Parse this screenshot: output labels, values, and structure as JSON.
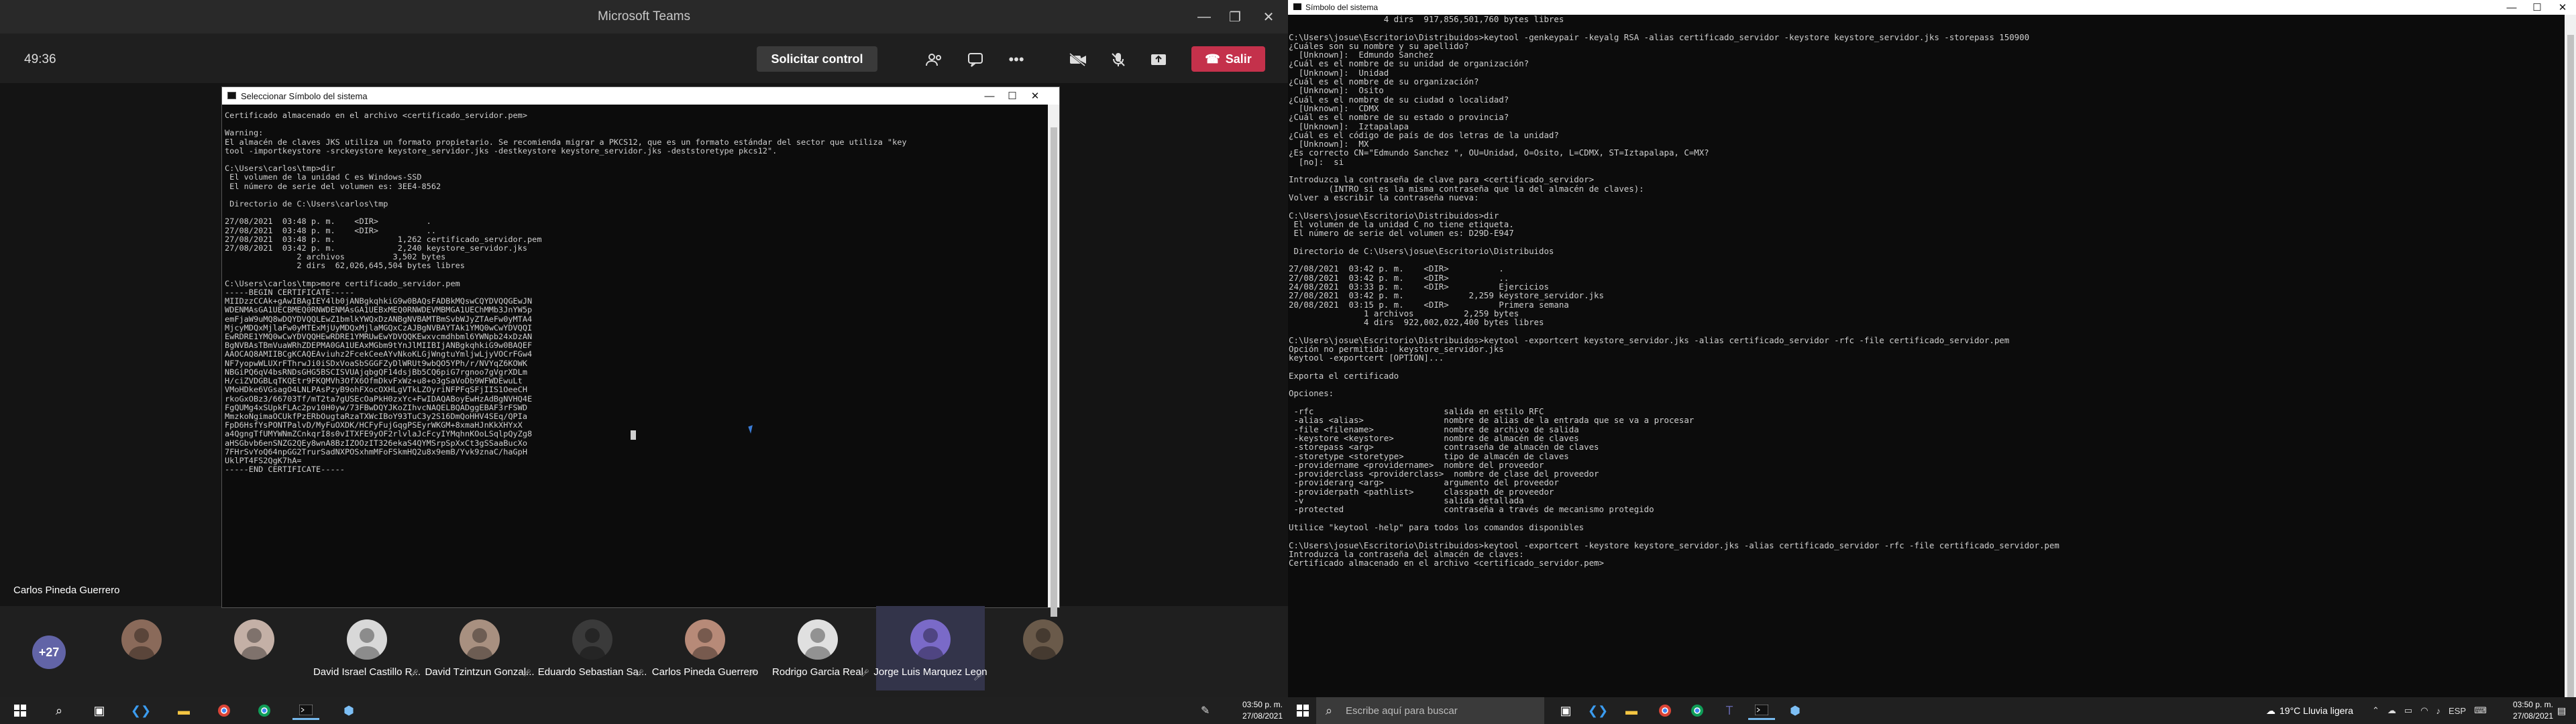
{
  "teams": {
    "title": "Microsoft Teams",
    "timer": "49:36",
    "request_control": "Solicitar control",
    "leave": "Salir",
    "presenter": "Carlos Pineda Guerrero",
    "more_count": "+27",
    "participants": [
      {
        "name": "",
        "color": "#8a6a5a"
      },
      {
        "name": "",
        "color": "#c4b0a6"
      },
      {
        "name": "David Israel Castillo R...",
        "color": "#d8d8d8"
      },
      {
        "name": "David Tzintzun Gonzal...",
        "color": "#a89080"
      },
      {
        "name": "Eduardo Sebastian Sa...",
        "color": "#3a3a3a"
      },
      {
        "name": "Carlos Pineda Guerrero",
        "color": "#b78a78"
      },
      {
        "name": "Rodrigo Garcia Real",
        "color": "#e0e0e0"
      },
      {
        "name": "Jorge Luis Marquez Leon",
        "color": "#7a6ac8"
      },
      {
        "name": "",
        "color": "#6a5a4a"
      }
    ]
  },
  "cmd1": {
    "title": "Seleccionar Símbolo del sistema",
    "text": "Certificado almacenado en el archivo <certificado_servidor.pem>\n\nWarning:\nEl almacén de claves JKS utiliza un formato propietario. Se recomienda migrar a PKCS12, que es un formato estándar del sector que utiliza \"key\ntool -importkeystore -srckeystore keystore_servidor.jks -destkeystore keystore_servidor.jks -deststoretype pkcs12\".\n\nC:\\Users\\carlos\\tmp>dir\n El volumen de la unidad C es Windows-SSD\n El número de serie del volumen es: 3EE4-8562\n\n Directorio de C:\\Users\\carlos\\tmp\n\n27/08/2021  03:48 p. m.    <DIR>          .\n27/08/2021  03:48 p. m.    <DIR>          ..\n27/08/2021  03:48 p. m.             1,262 certificado_servidor.pem\n27/08/2021  03:42 p. m.             2,240 keystore_servidor.jks\n               2 archivos          3,502 bytes\n               2 dirs  62,026,645,504 bytes libres\n\nC:\\Users\\carlos\\tmp>more certificado_servidor.pem\n-----BEGIN CERTIFICATE-----\nMIIDzzCCAk+gAwIBAgIEY4lb0jANBgkqhkiG9w0BAQsFADBkMQswCQYDVQQGEwJN\nWDENMAsGA1UECBMEQ0RNWDENMAsGA1UEBxMEQ0RNWDEVMBMGA1UEChMMb3JnYW5p\nemFjaW9uMQ8wDQYDVQQLEwZ1bmlkYWQxDzANBgNVBAMTBmSvbWJyZTAeFw0yMTA4\nMjcyMDQxMjlaFw0yMTExMjUyMDQxMjlaMGQxCzAJBgNVBAYTAk1YMQ0wCwYDVQQI\nEwRDRE1YMQ0wCwYDVQQHEwRDRE1YMRUwEwYDVQQKEwxvcmdhbml6YWNpb24xDzAN\nBgNVBAsTBmVuaWRhZDEPMA0GA1UEAxMGbm9tYnJlMIIBIjANBgkqhkiG9w0BAQEF\nAAOCAQ8AMIIBCgKCAQEAviuhz2FcekCeeAYvNkoKLGjWngtuYmljwLjyVOCrFGw4\nNF7yopwWLUXrFThrwJi0iSDxVoaSbSGGFZyDlWRUt9wbQO5YPh/r/NVYqZ6KOWK\nNBGiPQ6qV4bsRNDsGHG5BSCISVUAjqbgQF14dsjBb5CQ6piG7rgnoo7gVgrXDLm\nH/ciZVDGBLqTKQEtr9FKQMVh3OfX6OfmDkvFxWz+u8+o3gSaVoDb9WFWDEwuLt\nVMoHDke6VGsagO4LNLPAsPzyB9ohFXocOXHLgVTkLZOyriNFPFqSFjIIS1OeeCH\nrkoGxOBz3/66703Tf/mT2ta7gUSEcOaPkH0zxYc+FwIDAQABoyEwHzAdBgNVHQ4E\nFgQUMg4xSUpkFLAc2pv10H0yw/73FBwDQYJKoZIhvcNAQELBQADggEBAF3rFSWD\nMmzkoNgimaOCUkfPzERbOugtaRzaTXWcIBoY93TuC3y2S16DmQoHHV4SEq/QPIa\nFpD6HsfYsPONTPalvD/MyFuOXDK/HCFyFujGqgPSEyrWKGM+8xmaHJnKkXHYxX\na4QgngTfUMYWNmZCnkqrI8s0vITXFE9yOF2rlvlaJcFcyIYMqhnKOoLSqlpQyZg8\naHSGbvb6enSNZG2QEy8wnA8BzIZOOzIT326ekaS4QYMSrpSpXxCt3gSSaaBucXo\n7FHrSvYoQ64npGG2TrurSadNXPOSxhmMFoFSkmHQ2u8x9emB/Yvk9znaC/haGpH\nUklPT4FS2QgK7hA=\n-----END CERTIFICATE-----"
  },
  "cmd2": {
    "title": "Símbolo del sistema",
    "text": "                   4 dirs  917,856,501,760 bytes libres\n\nC:\\Users\\josue\\Escritorio\\Distribuidos>keytool -genkeypair -keyalg RSA -alias certificado_servidor -keystore keystore_servidor.jks -storepass 150900\n¿Cuáles son su nombre y su apellido?\n  [Unknown]:  Edmundo Sanchez\n¿Cuál es el nombre de su unidad de organización?\n  [Unknown]:  Unidad\n¿Cuál es el nombre de su organización?\n  [Unknown]:  Osito\n¿Cuál es el nombre de su ciudad o localidad?\n  [Unknown]:  CDMX\n¿Cuál es el nombre de su estado o provincia?\n  [Unknown]:  Iztapalapa\n¿Cuál es el código de país de dos letras de la unidad?\n  [Unknown]:  MX\n¿Es correcto CN=\"Edmundo Sanchez \", OU=Unidad, O=Osito, L=CDMX, ST=Iztapalapa, C=MX?\n  [no]:  si\n\nIntroduzca la contraseña de clave para <certificado_servidor>\n        (INTRO si es la misma contraseña que la del almacén de claves):\nVolver a escribir la contraseña nueva:\n\nC:\\Users\\josue\\Escritorio\\Distribuidos>dir\n El volumen de la unidad C no tiene etiqueta.\n El número de serie del volumen es: D29D-E947\n\n Directorio de C:\\Users\\josue\\Escritorio\\Distribuidos\n\n27/08/2021  03:42 p. m.    <DIR>          .\n27/08/2021  03:42 p. m.    <DIR>          ..\n24/08/2021  03:33 p. m.    <DIR>          Ejercicios\n27/08/2021  03:42 p. m.             2,259 keystore_servidor.jks\n20/08/2021  03:15 p. m.    <DIR>          Primera semana\n               1 archivos          2,259 bytes\n               4 dirs  922,002,022,400 bytes libres\n\nC:\\Users\\josue\\Escritorio\\Distribuidos>keytool -exportcert keystore_servidor.jks -alias certificado_servidor -rfc -file certificado_servidor.pem\nOpción no permitida:  keystore_servidor.jks\nkeytool -exportcert [OPTION]...\n\nExporta el certificado\n\nOpciones:\n\n -rfc                          salida en estilo RFC\n -alias <alias>                nombre de alias de la entrada que se va a procesar\n -file <filename>              nombre de archivo de salida\n -keystore <keystore>          nombre de almacén de claves\n -storepass <arg>              contraseña de almacén de claves\n -storetype <storetype>        tipo de almacén de claves\n -providername <providername>  nombre del proveedor\n -providerclass <providerclass>  nombre de clase del proveedor\n -providerarg <arg>            argumento del proveedor\n -providerpath <pathlist>      classpath de proveedor\n -v                            salida detallada\n -protected                    contraseña a través de mecanismo protegido\n\nUtilice \"keytool -help\" para todos los comandos disponibles\n\nC:\\Users\\josue\\Escritorio\\Distribuidos>keytool -exportcert -keystore keystore_servidor.jks -alias certificado_servidor -rfc -file certificado_servidor.pem\nIntroduzca la contraseña del almacén de claves:\nCertificado almacenado en el archivo <certificado_servidor.pem>"
  },
  "taskbar": {
    "search_placeholder": "Escribe aquí para buscar",
    "time_left": "03:50 p. m.",
    "date_left": "27/08/2021",
    "weather": "19°C  Lluvia ligera",
    "lang": "ESP",
    "time_right": "03:50 p. m.",
    "date_right": "27/08/2021"
  },
  "colors": {
    "leave_button": "#c4314b",
    "teams_accent": "#6264a7",
    "taskbar": "#202020",
    "terminal_bg": "#0c0c0c"
  }
}
